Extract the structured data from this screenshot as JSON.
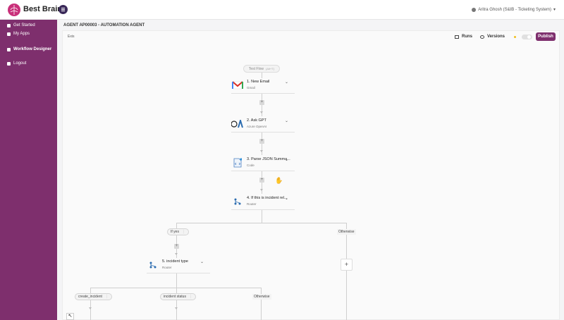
{
  "app": {
    "brand": "Best Brain"
  },
  "header": {
    "user": "Aritra Ghosh (S&IB - Ticketing System)"
  },
  "sidebar": {
    "items": [
      {
        "label": "Get Started",
        "icon": "people-icon"
      },
      {
        "label": "My Apps",
        "icon": "user-icon"
      },
      {
        "label": "Workflow Designer",
        "icon": "gear-icon"
      },
      {
        "label": "Logout",
        "icon": "logout-icon"
      }
    ]
  },
  "page": {
    "title": "AGENT AP00003 - AUTOMATION AGENT",
    "tiny_label": "Exis"
  },
  "toolbar": {
    "runs": "Runs",
    "versions": "Versions",
    "publish": "Publish"
  },
  "flow": {
    "test_flow": "Test Flow",
    "test_flow_sub": "(Alt+T)",
    "nodes": [
      {
        "title": "1. New Email",
        "subtitle": "Gmail"
      },
      {
        "title": "2. Ask GPT",
        "subtitle": "Azure OpenAI"
      },
      {
        "title": "3. Parse JSON Summa...",
        "subtitle": "Code"
      },
      {
        "title": "4. If this is incident rel...",
        "subtitle": "Router"
      },
      {
        "title": "5. incident type",
        "subtitle": "Router"
      }
    ],
    "branches": {
      "if_yes": "If yes",
      "otherwise": "Otherwise",
      "create_incident": "create_incident",
      "incident_status": "incident status",
      "otherwise_2": "Otherwise"
    },
    "plus": "+"
  },
  "colors": {
    "brand": "#7e2f6d",
    "sidebar_bg": "#7e2f6d",
    "publish_bg": "#7e2f6d"
  }
}
